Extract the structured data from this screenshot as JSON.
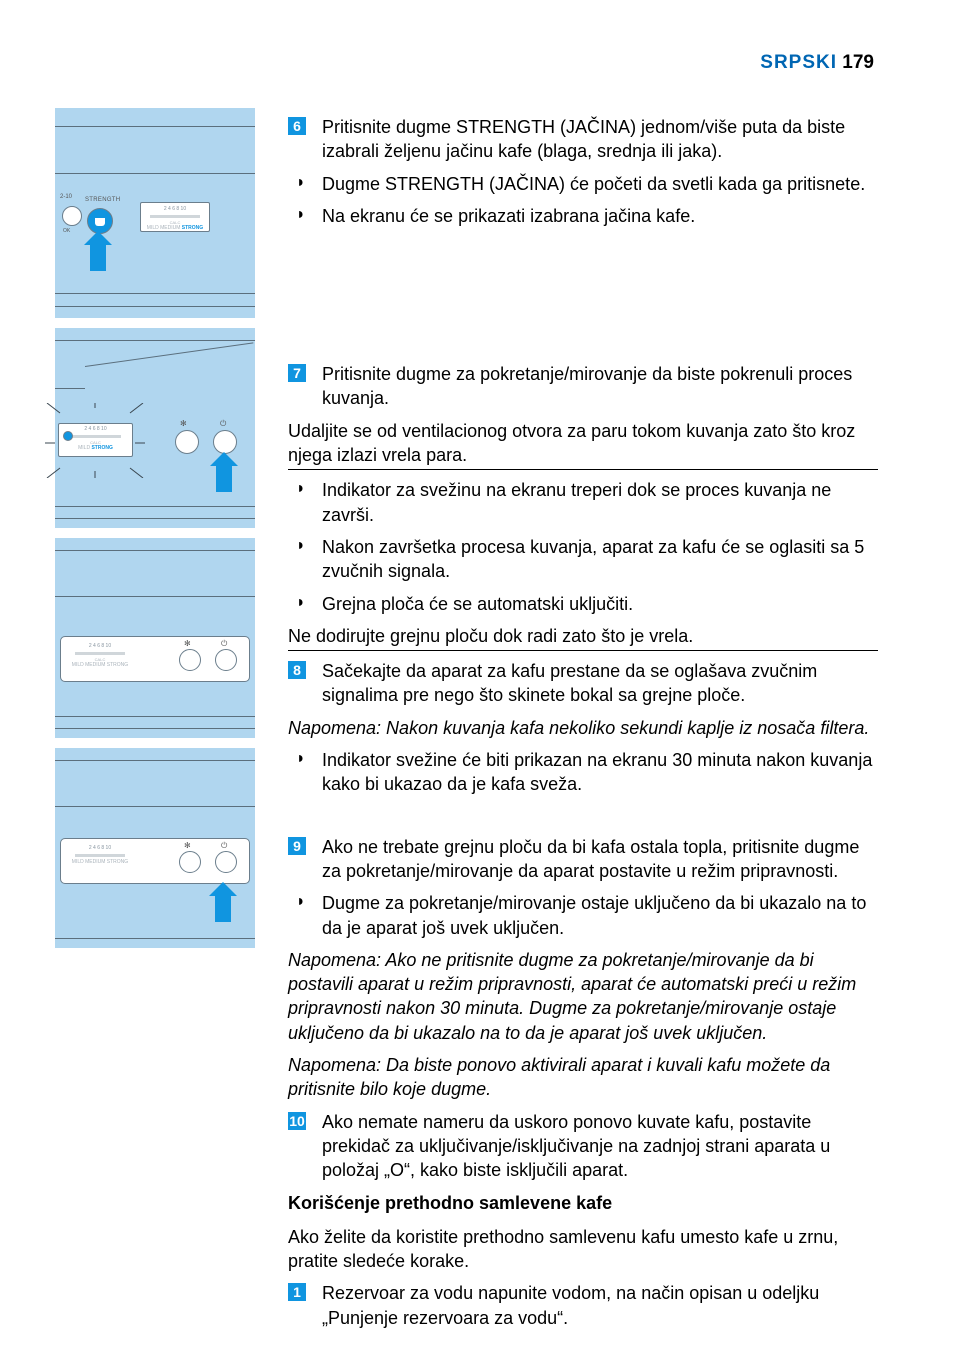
{
  "header": {
    "lang": "SRPSKI",
    "page": "179"
  },
  "steps": {
    "s6": "Pritisnite dugme STRENGTH (JAČINA) jednom/više puta da biste izabrali željenu jačinu kafe (blaga, srednja ili jaka).",
    "s6_b1": "Dugme STRENGTH (JAČINA) će početi da svetli kada ga pritisnete.",
    "s6_b2": "Na ekranu će se prikazati izabrana jačina kafe.",
    "s7": "Pritisnite dugme za pokretanje/mirovanje da biste pokrenuli proces kuvanja.",
    "warn7": "Udaljite se od ventilacionog otvora za paru tokom kuvanja zato što kroz njega izlazi vrela para.",
    "s7_b1": "Indikator za svežinu na ekranu treperi dok se proces kuvanja ne završi.",
    "s7_b2": "Nakon završetka procesa kuvanja, aparat za kafu će se oglasiti sa 5 zvučnih signala.",
    "s7_b3": "Grejna ploča će se automatski uključiti.",
    "warn7b": "Ne dodirujte grejnu ploču dok radi zato što je vrela.",
    "s8": "Sačekajte da aparat za kafu prestane da se oglašava zvučnim signalima pre nego što skinete bokal sa grejne ploče.",
    "note8": "Napomena: Nakon kuvanja kafa nekoliko sekundi kaplje iz nosača filtera.",
    "s8_b1": "Indikator svežine će biti prikazan na ekranu 30 minuta nakon kuvanja kako bi ukazao da je kafa sveža.",
    "s9": "Ako ne trebate grejnu ploču da bi kafa ostala topla, pritisnite dugme za pokretanje/mirovanje da aparat postavite u režim pripravnosti.",
    "s9_b1": "Dugme za pokretanje/mirovanje ostaje uključeno da bi ukazalo na to da je aparat još uvek uključen.",
    "note9a": "Napomena: Ako ne pritisnite dugme za pokretanje/mirovanje da bi postavili aparat u režim pripravnosti, aparat će automatski preći u režim pripravnosti nakon 30 minuta. Dugme za pokretanje/mirovanje ostaje uključeno da bi ukazalo na to da je aparat još uvek uključen.",
    "note9b": "Napomena: Da biste ponovo aktivirali aparat i kuvali kafu možete da pritisnite bilo koje dugme.",
    "s10": "Ako nemate nameru da uskoro ponovo kuvate kafu, postavite prekidač za uključivanje/isključivanje na zadnjoj strani aparata u položaj „O“, kako biste isključili aparat.",
    "subhead": "Korišćenje prethodno samlevene kafe",
    "intro": "Ako želite da koristite prethodno samlevenu kafu umesto kafe u zrnu, pratite sledeće korake.",
    "s1": "Rezervoar za vodu napunite vodom, na način opisan u odeljku „Punjenje rezervoara za vodu“."
  },
  "illus": {
    "label_strength": "STRENGTH",
    "label_210": "2-10",
    "label_ok": "OK"
  }
}
